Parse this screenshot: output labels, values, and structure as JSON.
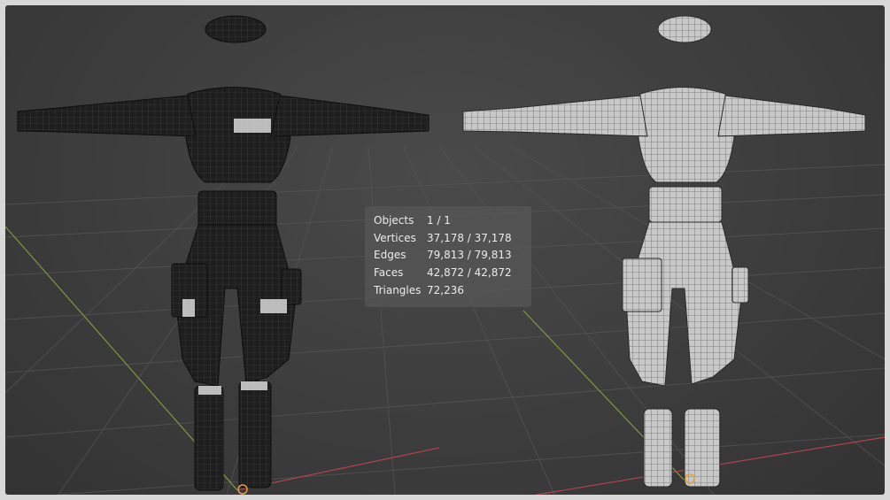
{
  "stats_overlay": {
    "rows": [
      {
        "label": "Objects",
        "value": "1 / 1"
      },
      {
        "label": "Vertices",
        "value": "37,178 / 37,178"
      },
      {
        "label": "Edges",
        "value": "79,813 / 79,813"
      },
      {
        "label": "Faces",
        "value": "42,872 / 42,872"
      },
      {
        "label": "Triangles",
        "value": "72,236"
      }
    ]
  },
  "colors": {
    "viewport_bg": "#3d3d3d",
    "frame": "#d8d8d8",
    "grid_line": "#555555",
    "x_axis": "#b3424f",
    "y_axis": "#7d9a3d",
    "overlay_bg": "#585858",
    "origin_marker": "#e0a040",
    "model_dark": "#1c1c1c",
    "model_light": "#c9c9c9"
  },
  "viewport": {
    "models": [
      {
        "shading": "dark wireframe overlay",
        "icon": "character-model"
      },
      {
        "shading": "light clay wireframe",
        "icon": "character-model"
      }
    ]
  }
}
